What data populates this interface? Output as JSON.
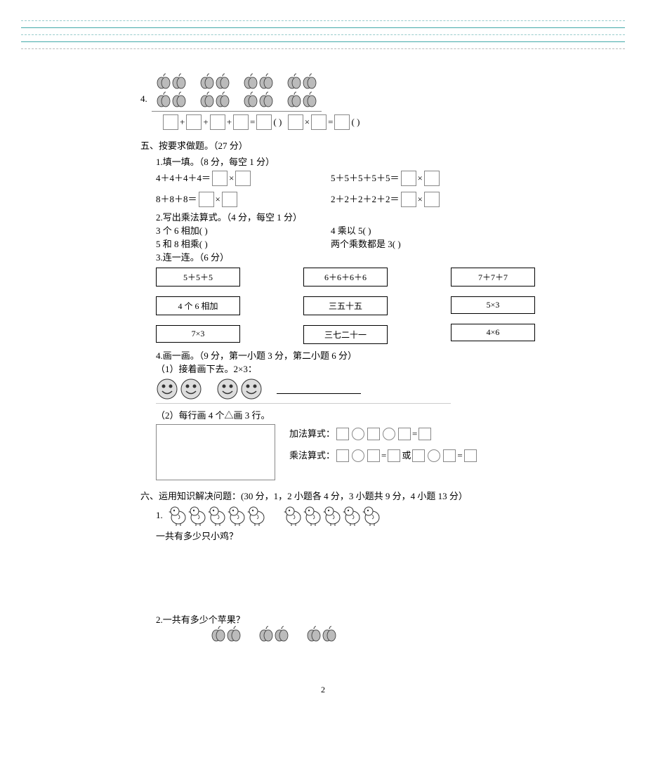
{
  "q4": {
    "num": "4.",
    "eq_add_suffix": "(         )",
    "mult_sign": "×",
    "plus_sign": "+",
    "equals": "=",
    "eq_mult_suffix": "(         )"
  },
  "sec5": {
    "title": "五、按要求做题。（27 分）",
    "p1": {
      "title": "1.填一填。（8 分，每空 1 分）",
      "r1a": "4＋4＋4＋4＝",
      "r1b": "5＋5＋5＋5＋5＝",
      "r2a": "8＋8＋8＝",
      "r2b": "2＋2＋2＋2＋2＝",
      "times": "×"
    },
    "p2": {
      "title": "2.写出乘法算式。（4 分，每空 1 分）",
      "a1": "3 个 6 相加(          )",
      "a2": "4 乘以 5(          )",
      "b1": "5 和 8 相乘(          )",
      "b2": "两个乘数都是 3(          )"
    },
    "p3": {
      "title": "3.连一连。（6 分）",
      "col1": [
        "5＋5＋5",
        "4 个 6 相加",
        "7×3"
      ],
      "col2": [
        "6＋6＋6＋6",
        "三五十五",
        "三七二十一"
      ],
      "col3": [
        "7＋7＋7",
        "5×3",
        "4×6"
      ]
    },
    "p4": {
      "title": "4.画一画。（9 分，第一小题 3 分，第二小题 6 分）",
      "sub1": "（1）接着画下去。2×3：",
      "sub2": "（2）每行画 4 个△画 3 行。",
      "add_label": "加法算式：",
      "mult_label": "乘法算式：",
      "or": "或",
      "eq": "="
    }
  },
  "sec6": {
    "title": "六、运用知识解决问题：(30 分，1，2 小题各 4 分，3 小题共 9 分，4 小题 13 分）",
    "q1num": "1.",
    "q1text": "一共有多少只小鸡？",
    "q2": "2.一共有多少个苹果？"
  },
  "page_num": "2"
}
